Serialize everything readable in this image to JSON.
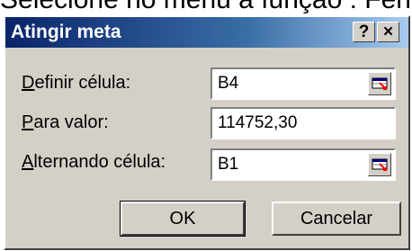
{
  "background": {
    "text": "Selecione no menu a função : Ferr"
  },
  "dialog": {
    "title": "Atingir meta",
    "help_label": "?",
    "close_label": "×",
    "fields": [
      {
        "label_accel": "D",
        "label_rest": "efinir célula:",
        "value": "B4",
        "has_ref_button": true
      },
      {
        "label_accel": "P",
        "label_rest": "ara valor:",
        "value": "114752,30",
        "has_ref_button": false
      },
      {
        "label_accel": "A",
        "label_rest": "lternando célula:",
        "value": "B1",
        "has_ref_button": true
      }
    ],
    "ok_label": "OK",
    "cancel_label": "Cancelar"
  },
  "colors": {
    "dialog_bg": "#d4d0c8",
    "titlebar_start": "#0a246a",
    "titlebar_end": "#a6caf0"
  },
  "icons": {
    "ref_button": "collapse-dialog-icon"
  }
}
